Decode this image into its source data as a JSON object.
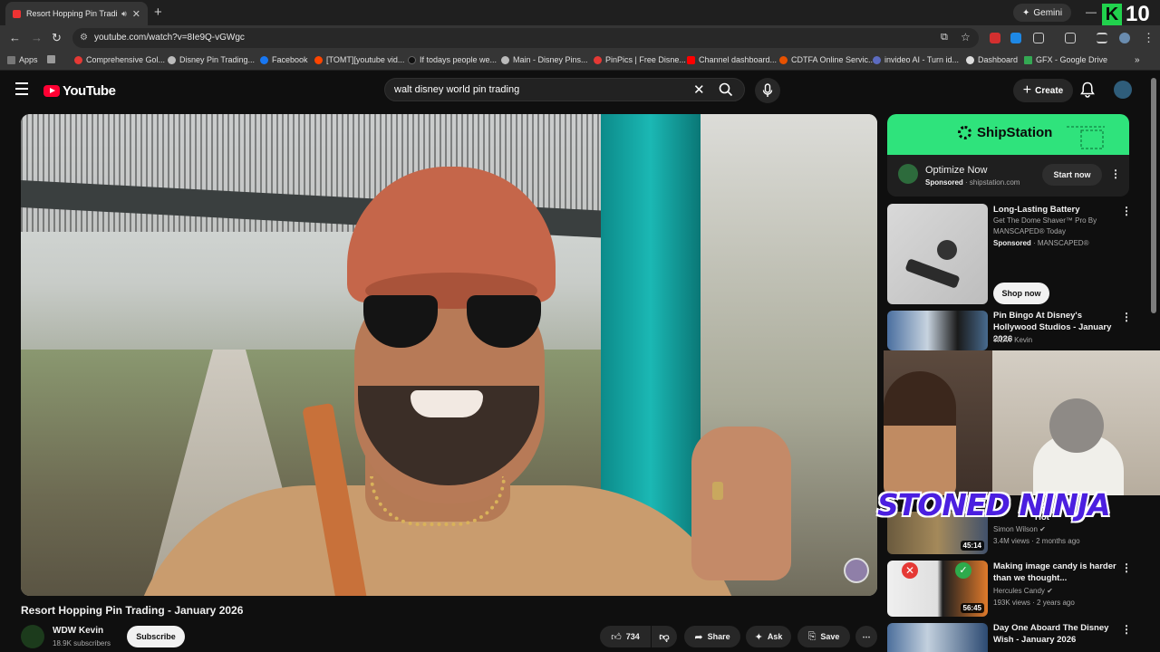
{
  "browser": {
    "tab_title": "Resort Hopping Pin Trading",
    "url": "youtube.com/watch?v=8Ie9Q-vGWgc",
    "gemini_label": "Gemini",
    "overlay_badge": "10",
    "bookmarks": [
      {
        "label": "Apps",
        "color": "#4285f4"
      },
      {
        "label": "Comprehensive Gol...",
        "color": "#e53935"
      },
      {
        "label": "Disney Pin Trading...",
        "color": "#9e9e9e"
      },
      {
        "label": "Facebook",
        "color": "#1877f2"
      },
      {
        "label": "[TOMT][youtube vid...",
        "color": "#ff4500"
      },
      {
        "label": "If todays people we...",
        "color": "#111111"
      },
      {
        "label": "Main - Disney Pins...",
        "color": "#bbbbbb"
      },
      {
        "label": "PinPics | Free Disne...",
        "color": "#e53935"
      },
      {
        "label": "Channel dashboard...",
        "color": "#ff0000"
      },
      {
        "label": "CDTFA Online Servic...",
        "color": "#e65100"
      },
      {
        "label": "invideo AI - Turn id...",
        "color": "#5c6bc0"
      },
      {
        "label": "Dashboard",
        "color": "#dddddd"
      },
      {
        "label": "GFX - Google Drive",
        "color": "#34a853"
      }
    ]
  },
  "youtube": {
    "logo_text": "YouTube",
    "search_query": "walt disney world pin trading",
    "create_label": "Create"
  },
  "video": {
    "title": "Resort Hopping Pin Trading - January 2026",
    "channel": "WDW Kevin",
    "subscribers": "18.9K subscribers",
    "subscribe_label": "Subscribe",
    "likes": "734",
    "share_label": "Share",
    "ask_label": "Ask",
    "save_label": "Save"
  },
  "ad": {
    "brand": "ShipStation",
    "headline": "Optimize Now",
    "sponsored": "Sponsored",
    "domain": "shipstation.com",
    "cta": "Start now"
  },
  "sidebar": {
    "items": [
      {
        "title": "Long-Lasting Battery",
        "line2": "Get The Dome Shaver™ Pro By",
        "line3": "MANSCAPED® Today",
        "sponsored": "Sponsored",
        "advertiser": "MANSCAPED®",
        "cta": "Shop now"
      },
      {
        "title": "Pin Bingo At Disney's Hollywood Studios - January 2026",
        "channel": "WDW Kevin"
      },
      {
        "title_partial": "rica",
        "title_partial2": "Hot",
        "channel": "Simon Wilson",
        "views": "3.4M views · 2 months ago",
        "duration": "45:14"
      },
      {
        "title": "Making image candy is harder than we thought...",
        "channel": "Hercules Candy",
        "views": "193K views · 2 years ago",
        "duration": "56:45"
      },
      {
        "title": "Day One Aboard The Disney Wish - January 2026"
      }
    ]
  },
  "overlay": {
    "text": "STONED NINJA"
  }
}
